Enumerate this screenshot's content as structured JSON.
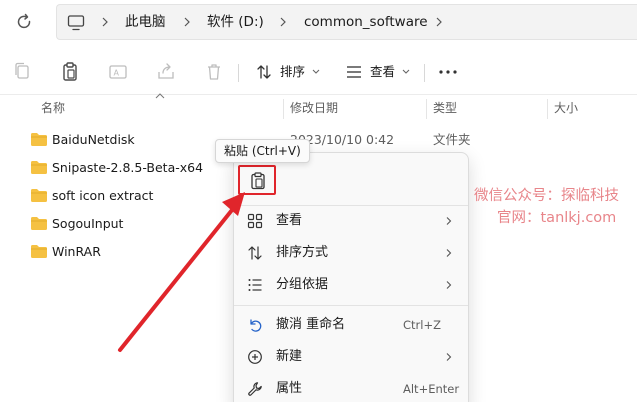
{
  "breadcrumb": {
    "items": [
      "此电脑",
      "软件 (D:)",
      "common_software"
    ]
  },
  "toolbar": {
    "sort_label": "排序",
    "view_label": "查看"
  },
  "columns": {
    "name": "名称",
    "modified": "修改日期",
    "type": "类型",
    "size": "大小"
  },
  "files": [
    {
      "name": "BaiduNetdisk",
      "modified": "2023/10/10 0:42",
      "type": "文件夹"
    },
    {
      "name": "Snipaste-2.8.5-Beta-x64",
      "modified": "",
      "type": ""
    },
    {
      "name": "soft icon extract",
      "modified": "",
      "type": ""
    },
    {
      "name": "SogouInput",
      "modified": "",
      "type": ""
    },
    {
      "name": "WinRAR",
      "modified": "",
      "type": ""
    }
  ],
  "tooltip": {
    "text": "粘贴 (Ctrl+V)"
  },
  "context_menu": {
    "items": [
      {
        "label": "查看",
        "shortcut": "",
        "icon": "grid-icon",
        "submenu": true
      },
      {
        "label": "排序方式",
        "shortcut": "",
        "icon": "sort-icon",
        "submenu": true
      },
      {
        "label": "分组依据",
        "shortcut": "",
        "icon": "list-icon",
        "submenu": true
      },
      {
        "label": "撤消 重命名",
        "shortcut": "Ctrl+Z",
        "icon": "undo-icon",
        "submenu": false
      },
      {
        "label": "新建",
        "shortcut": "",
        "icon": "add-circle-icon",
        "submenu": true
      },
      {
        "label": "属性",
        "shortcut": "Alt+Enter",
        "icon": "wrench-icon",
        "submenu": false
      }
    ]
  },
  "watermark": {
    "line1": "微信公众号：探临科技",
    "line2": "官网：tanlkj.com"
  },
  "colors": {
    "accent": "#005fb8",
    "highlight": "#e0252b",
    "folder": "#f5c142",
    "watermark": "#e8858a"
  }
}
